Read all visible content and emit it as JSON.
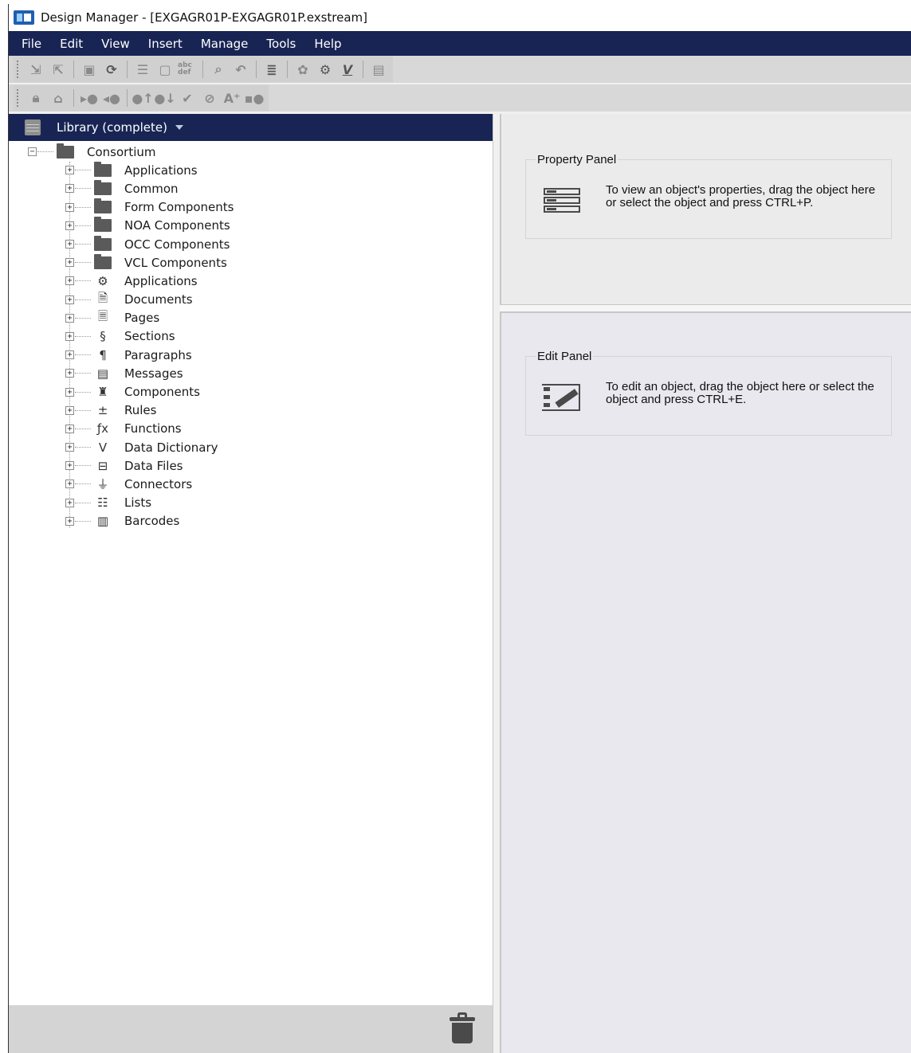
{
  "window": {
    "title": "Design Manager - [EXGAGR01P-EXGAGR01P.exstream]",
    "app_icon": "app-icon"
  },
  "menubar": {
    "items": [
      "File",
      "Edit",
      "View",
      "Insert",
      "Manage",
      "Tools",
      "Help"
    ]
  },
  "toolbar1": {
    "buttons": [
      "import-icon",
      "export-icon",
      "save-icon",
      "refresh-icon",
      "list-icon",
      "screen-icon",
      "spell-check-icon",
      "find-icon",
      "undo-icon",
      "layers-icon",
      "settings-icon",
      "gear-icon",
      "variable-icon",
      "server-icon"
    ],
    "spellcheck_glyph": "abc def",
    "variable_glyph": "V"
  },
  "toolbar2": {
    "buttons": [
      "lock-icon",
      "unlock-icon",
      "check-in-icon",
      "check-out-icon",
      "promote-icon",
      "demote-icon",
      "approve-icon",
      "reject-icon",
      "text-add-icon",
      "user-group-icon"
    ]
  },
  "library": {
    "label": "Library (complete)",
    "root": {
      "label": "Consortium",
      "expander": "−"
    },
    "children": [
      {
        "label": "Applications",
        "icon": "folder-icon"
      },
      {
        "label": "Common",
        "icon": "folder-icon"
      },
      {
        "label": "Form Components",
        "icon": "folder-icon"
      },
      {
        "label": "NOA Components",
        "icon": "folder-icon"
      },
      {
        "label": "OCC Components",
        "icon": "folder-icon"
      },
      {
        "label": "VCL Components",
        "icon": "folder-icon"
      },
      {
        "label": "Applications",
        "icon": "gears-icon",
        "glyph": "⚙"
      },
      {
        "label": "Documents",
        "icon": "document-icon",
        "glyph": "🗎"
      },
      {
        "label": "Pages",
        "icon": "page-icon",
        "glyph": "🗏"
      },
      {
        "label": "Sections",
        "icon": "section-icon",
        "glyph": "§"
      },
      {
        "label": "Paragraphs",
        "icon": "pilcrow-icon",
        "glyph": "¶"
      },
      {
        "label": "Messages",
        "icon": "message-icon",
        "glyph": "▤"
      },
      {
        "label": "Components",
        "icon": "puzzle-icon",
        "glyph": "♜"
      },
      {
        "label": "Rules",
        "icon": "rule-icon",
        "glyph": "±"
      },
      {
        "label": "Functions",
        "icon": "function-icon",
        "glyph": "ƒx"
      },
      {
        "label": "Data Dictionary",
        "icon": "variable-icon",
        "glyph": "V"
      },
      {
        "label": "Data Files",
        "icon": "data-file-icon",
        "glyph": "⊟"
      },
      {
        "label": "Connectors",
        "icon": "plug-icon",
        "glyph": "⏚"
      },
      {
        "label": "Lists",
        "icon": "list-add-icon",
        "glyph": "☷"
      },
      {
        "label": "Barcodes",
        "icon": "barcode-icon",
        "glyph": "▥"
      }
    ],
    "child_expander": "+"
  },
  "property_panel": {
    "title": "Property Panel",
    "text": "To view an object's properties, drag the object here or select the object and press CTRL+P."
  },
  "edit_panel": {
    "title": "Edit Panel",
    "text": "To edit an object, drag the object here or select the object and press CTRL+E."
  },
  "colors": {
    "menubar_bg": "#182554",
    "library_header_bg": "#182554"
  }
}
